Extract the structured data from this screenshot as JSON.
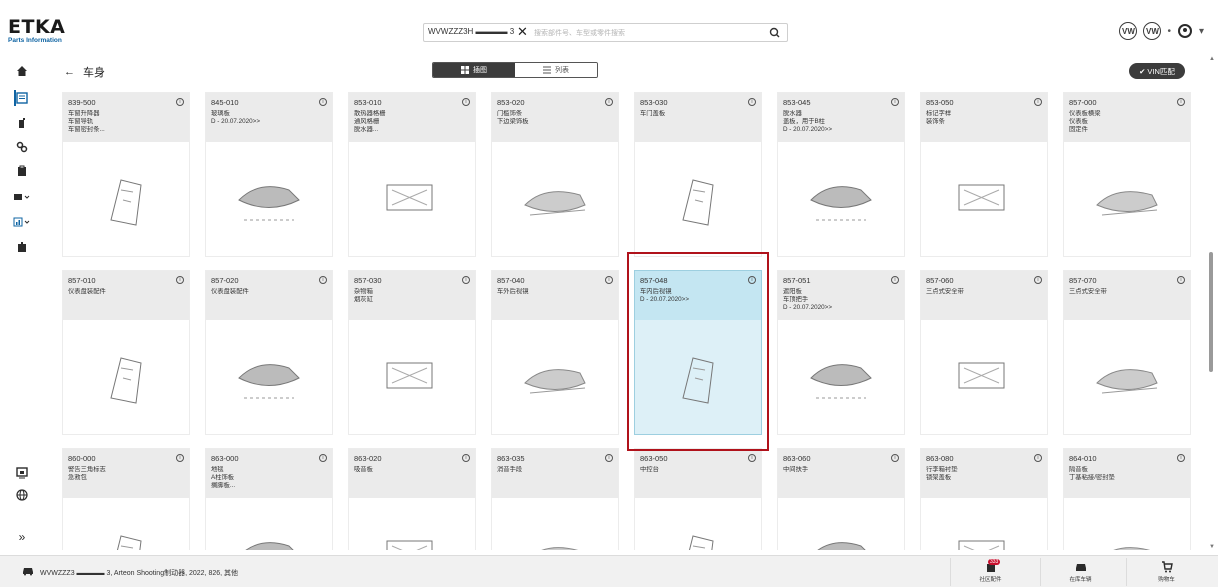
{
  "app": {
    "logo_text": "ETKA",
    "logo_sub": "Parts Information"
  },
  "search": {
    "vin_value": "WVWZZZ3H ▬▬▬▬ 3",
    "placeholder": "搜索部件号、车型或零件搜索",
    "clear_icon": "close-icon",
    "search_icon": "search-icon"
  },
  "header": {
    "brand1": "VW",
    "brand2": "VW",
    "separator": "•",
    "user_icon": "user-icon",
    "user_caret": "▾"
  },
  "subheader": {
    "back_label": "车身",
    "view_grid_label": "插图",
    "view_list_label": "列表",
    "vin_match_label": "VIN匹配"
  },
  "rail": {
    "icons": [
      "home-icon",
      "catalog-icon",
      "part-icon",
      "settings-icon",
      "clipboard-icon",
      "service-icon",
      "chart-icon",
      "export-icon",
      "screen-icon",
      "globe-icon",
      "expand-icon"
    ],
    "expand_label": "»"
  },
  "cards": [
    {
      "code": "839-500",
      "lines": [
        "车窗升降器",
        "车窗导轨",
        "车窗密封条..."
      ]
    },
    {
      "code": "845-010",
      "lines": [
        "玻璃板",
        "D - 20.07.2020>>"
      ]
    },
    {
      "code": "853-010",
      "lines": [
        "散热器格栅",
        "通风格栅",
        "脱水器..."
      ]
    },
    {
      "code": "853-020",
      "lines": [
        "门槛饰条",
        "下边梁饰板"
      ]
    },
    {
      "code": "853-030",
      "lines": [
        "车门盖板"
      ]
    },
    {
      "code": "853-045",
      "lines": [
        "脱水器",
        "盖板，用于B柱",
        "D - 20.07.2020>>"
      ]
    },
    {
      "code": "853-050",
      "lines": [
        "标记字样",
        "装饰条"
      ]
    },
    {
      "code": "857-000",
      "lines": [
        "仪表板横梁",
        "仪表板",
        "固定件"
      ]
    },
    {
      "code": "857-010",
      "lines": [
        "仪表盘装配件"
      ]
    },
    {
      "code": "857-020",
      "lines": [
        "仪表盘装配件"
      ]
    },
    {
      "code": "857-030",
      "lines": [
        "杂物箱",
        "烟灰缸"
      ]
    },
    {
      "code": "857-040",
      "lines": [
        "车外后视镜"
      ]
    },
    {
      "code": "857-048",
      "lines": [
        "车内后视镜",
        "D - 20.07.2020>>"
      ]
    },
    {
      "code": "857-051",
      "lines": [
        "遮阳板",
        "车顶把手",
        "D - 20.07.2020>>"
      ]
    },
    {
      "code": "857-060",
      "lines": [
        "三点式安全带"
      ]
    },
    {
      "code": "857-070",
      "lines": [
        "三点式安全带"
      ]
    },
    {
      "code": "860-000",
      "lines": [
        "警告三角标志",
        "急救包"
      ]
    },
    {
      "code": "863-000",
      "lines": [
        "地毯",
        "A柱饰板",
        "搁脚板..."
      ]
    },
    {
      "code": "863-020",
      "lines": [
        "吸音板"
      ]
    },
    {
      "code": "863-035",
      "lines": [
        "消音手段"
      ]
    },
    {
      "code": "863-050",
      "lines": [
        "中控台"
      ]
    },
    {
      "code": "863-060",
      "lines": [
        "中间扶手"
      ]
    },
    {
      "code": "863-080",
      "lines": [
        "行李箱衬垫",
        "锁架盖板"
      ]
    },
    {
      "code": "864-010",
      "lines": [
        "隔音板",
        "丁基粘接/密封垫"
      ]
    }
  ],
  "selected_card": "857-048",
  "footer": {
    "vehicle": "WVWZZZ3 ▬▬▬▬ 3, Arteon Shooting制动器, 2022, 826, 其他",
    "community_label": "社区配件",
    "community_badge": "333",
    "stock_label": "在库车辆",
    "cart_label": "购物车"
  },
  "colors": {
    "accent": "#0f64a3",
    "highlight": "#b0121b",
    "selected_bg": "#ddf0f7",
    "card_head": "#ebebeb",
    "dark_btn": "#3c3c3c"
  }
}
